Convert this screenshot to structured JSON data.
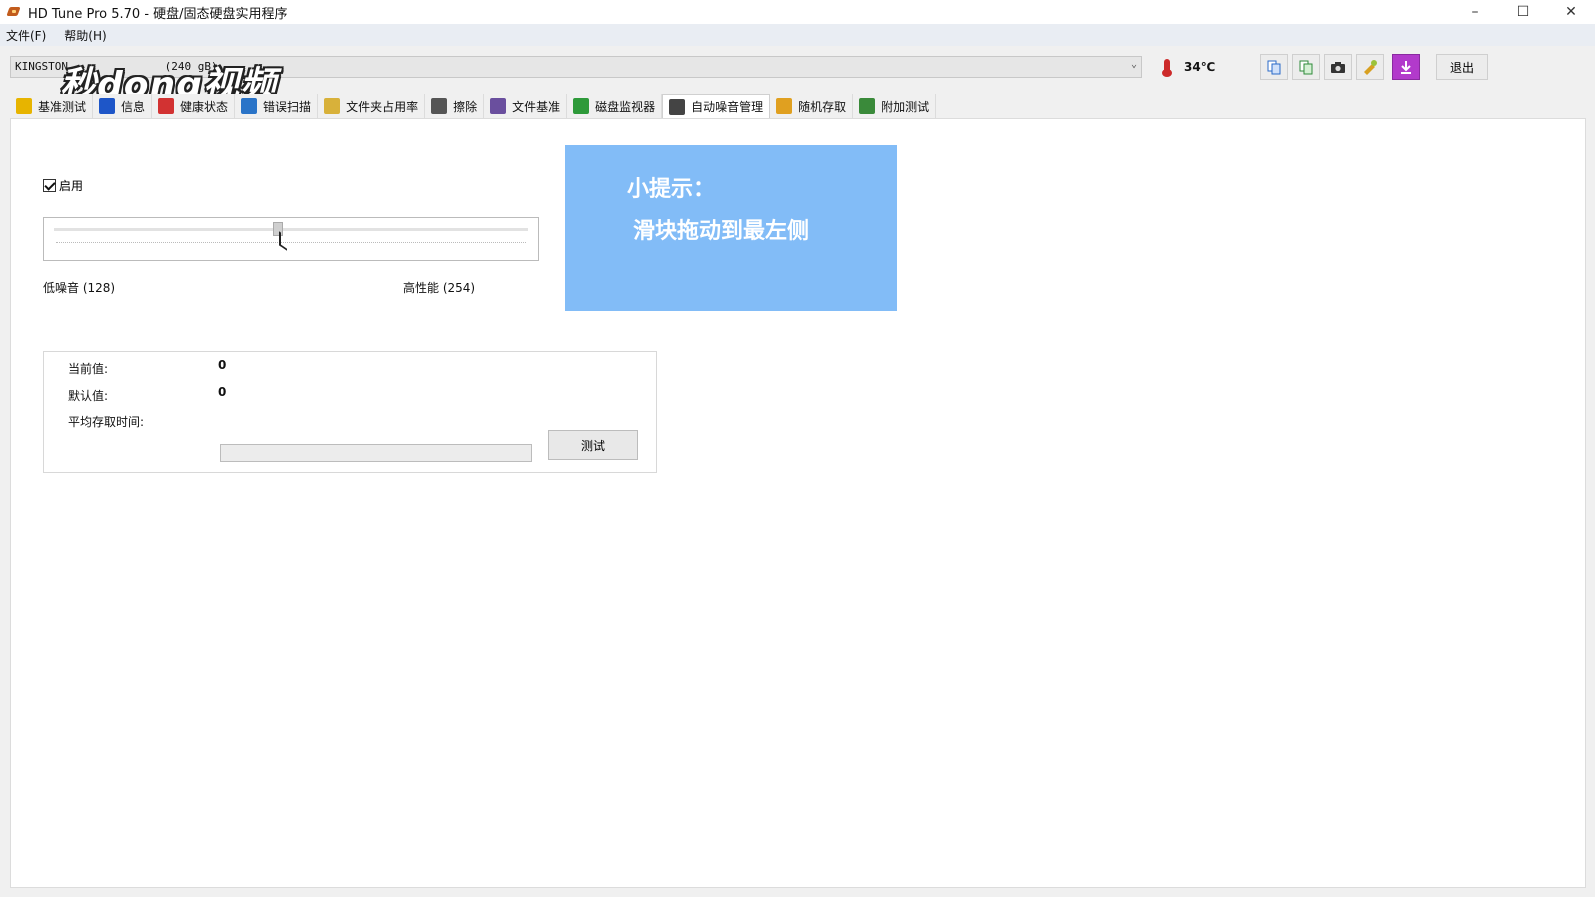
{
  "window": {
    "title": "HD Tune Pro 5.70 - 硬盘/固态硬盘实用程序",
    "minimize_glyph": "–",
    "maximize_glyph": "☐",
    "close_glyph": "✕"
  },
  "menu": {
    "items": [
      "文件(F)",
      "帮助(H)"
    ]
  },
  "toolbar": {
    "drive_label": "KINGSTON",
    "drive_size": "(240 gB)",
    "temperature": "34℃",
    "exit_label": "退出",
    "button_icons": [
      "copy-icon",
      "copy-info-icon",
      "screenshot-icon",
      "options-icon",
      "save-download-icon"
    ]
  },
  "tabs": [
    {
      "label": "基准测试",
      "icon": "benchmark-icon",
      "color": "#e7b400"
    },
    {
      "label": "信息",
      "icon": "info-icon",
      "color": "#1e56c8"
    },
    {
      "label": "健康状态",
      "icon": "health-icon",
      "color": "#d23232"
    },
    {
      "label": "错误扫描",
      "icon": "error-scan-icon",
      "color": "#2a74c8"
    },
    {
      "label": "文件夹占用率",
      "icon": "folder-usage-icon",
      "color": "#d8b13a"
    },
    {
      "label": "擦除",
      "icon": "erase-icon",
      "color": "#555555"
    },
    {
      "label": "文件基准",
      "icon": "file-benchmark-icon",
      "color": "#6a4f9e"
    },
    {
      "label": "磁盘监视器",
      "icon": "disk-monitor-icon",
      "color": "#2e9a3a"
    },
    {
      "label": "自动噪音管理",
      "icon": "speaker-icon",
      "color": "#444444",
      "active": true
    },
    {
      "label": "随机存取",
      "icon": "random-access-icon",
      "color": "#e0a020"
    },
    {
      "label": "附加测试",
      "icon": "extra-tests-icon",
      "color": "#3a8a3a"
    }
  ],
  "aam": {
    "enable_label": "启用",
    "enabled": true,
    "slider_position": 0.47,
    "low_label": "低噪音 (128)",
    "high_label": "高性能 (254)"
  },
  "tip": {
    "line1": "小提示：",
    "line2": "滑块拖动到最左侧",
    "color": "#82bcf7"
  },
  "stats": {
    "current_label": "当前值:",
    "current_value": "0",
    "default_label": "默认值:",
    "default_value": "0",
    "avg_access_label": "平均存取时间:",
    "test_button": "测试"
  },
  "watermark": {
    "text": "秒dong视频"
  }
}
